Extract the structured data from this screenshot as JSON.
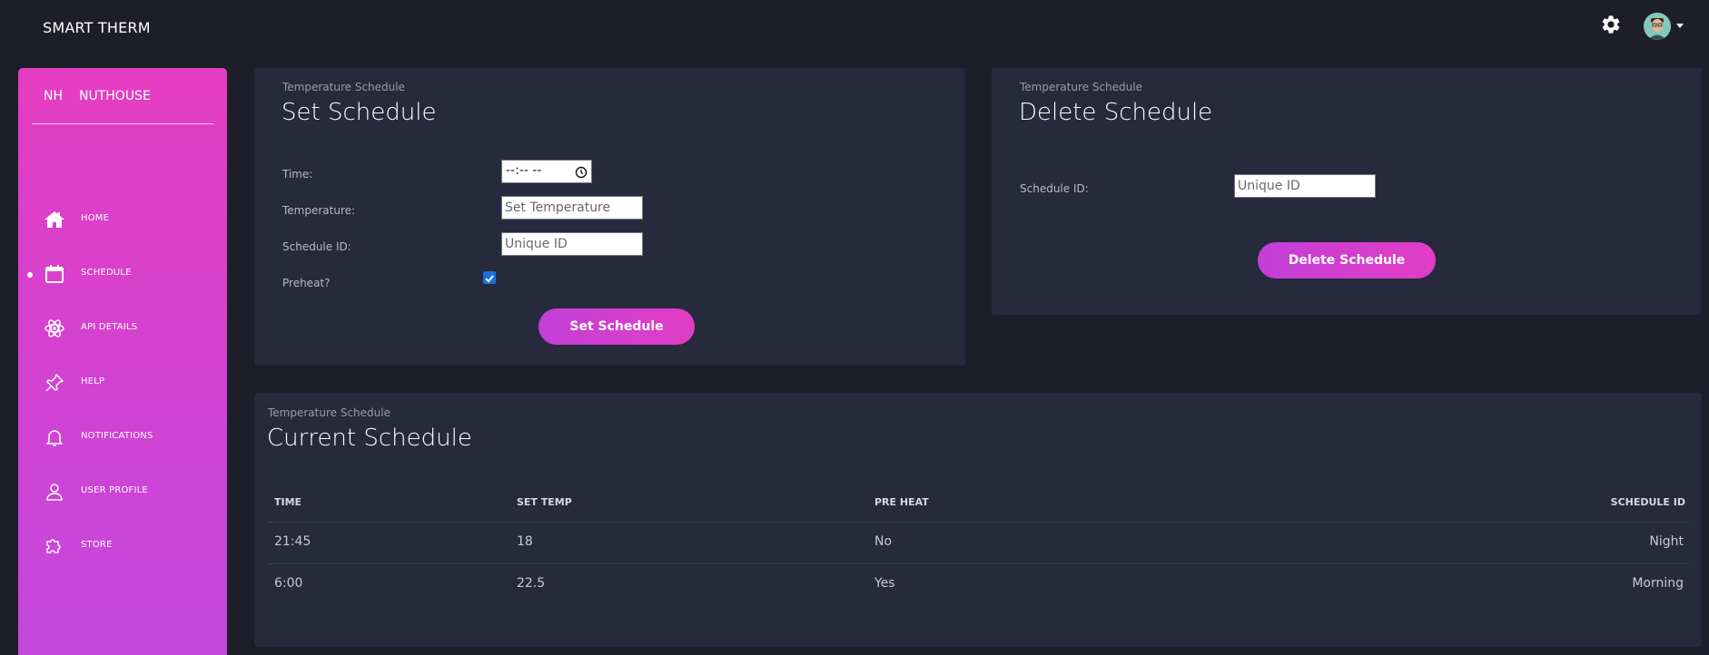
{
  "navbar": {
    "brand": "SMART THERM",
    "settings_icon": "gear-icon",
    "avatar_icon": "user-avatar"
  },
  "sidebar": {
    "logo_mini": "NH",
    "logo_name": "NUTHOUSE",
    "active_item": "SCHEDULE",
    "items": [
      {
        "label": "HOME",
        "icon": "home-icon"
      },
      {
        "label": "SCHEDULE",
        "icon": "calendar-icon"
      },
      {
        "label": "API DETAILS",
        "icon": "atom-icon"
      },
      {
        "label": "HELP",
        "icon": "pin-icon"
      },
      {
        "label": "NOTIFICATIONS",
        "icon": "bell-icon"
      },
      {
        "label": "USER PROFILE",
        "icon": "user-icon"
      },
      {
        "label": "STORE",
        "icon": "puzzle-icon"
      }
    ],
    "gradient": [
      "#e53dc2",
      "#c248dd"
    ]
  },
  "set_schedule": {
    "category": "Temperature Schedule",
    "title": "Set Schedule",
    "time_label": "Time:",
    "time_value": "--:-- --",
    "temperature_label": "Temperature:",
    "temperature_placeholder": "Set Temperature",
    "schedule_id_label": "Schedule ID:",
    "schedule_id_placeholder": "Unique ID",
    "preheat_label": "Preheat?",
    "preheat_checked": true,
    "button_label": "Set Schedule"
  },
  "delete_schedule": {
    "category": "Temperature Schedule",
    "title": "Delete Schedule",
    "schedule_id_label": "Schedule ID:",
    "schedule_id_placeholder": "Unique ID",
    "button_label": "Delete Schedule"
  },
  "current_schedule": {
    "category": "Temperature Schedule",
    "title": "Current Schedule",
    "columns": [
      "TIME",
      "SET TEMP",
      "PRE HEAT",
      "SCHEDULE ID"
    ],
    "rows": [
      [
        "21:45",
        "18",
        "No",
        "Night"
      ],
      [
        "6:00",
        "22.5",
        "Yes",
        "Morning"
      ]
    ]
  },
  "colors": {
    "background": "#1e1e2b",
    "card": "#27293d",
    "accent": "#e23dc4"
  }
}
